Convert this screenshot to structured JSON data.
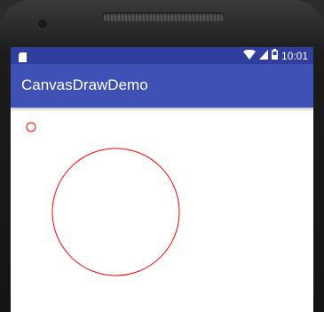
{
  "status_bar": {
    "time": "10:01",
    "icons": [
      "sd-card-icon",
      "wifi-icon",
      "cell-signal-icon",
      "battery-icon"
    ],
    "color": "#303F9F"
  },
  "app_bar": {
    "title": "CanvasDrawDemo",
    "color": "#3F51B5"
  },
  "canvas": {
    "background": "#ffffff",
    "stroke_color": "#FF0000",
    "shapes": [
      "circle",
      "circle"
    ]
  }
}
